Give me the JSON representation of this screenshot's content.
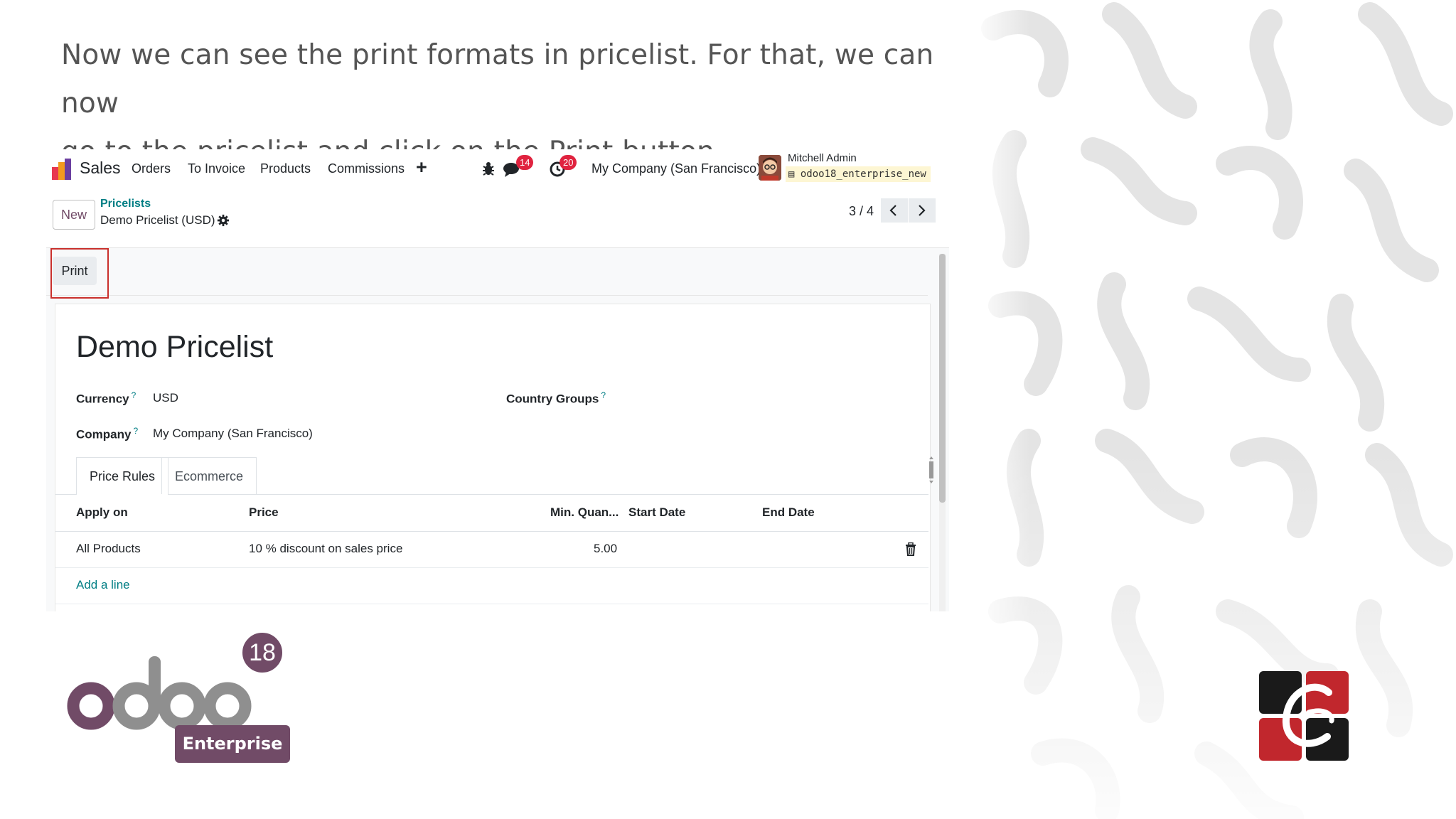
{
  "caption": {
    "line1": "Now we can see the print formats in pricelist. For that, we can now",
    "line2": "go to the pricelist and click on the Print button."
  },
  "navbar": {
    "app_name": "Sales",
    "menu": [
      "Orders",
      "To Invoice",
      "Products",
      "Commissions"
    ],
    "messages_count": "14",
    "activities_count": "20",
    "company": "My Company (San Francisco)",
    "user_name": "Mitchell Admin",
    "database": "odoo18_enterprise_new",
    "icons": [
      "plus-icon",
      "bug-icon",
      "chat-icon",
      "clock-icon"
    ]
  },
  "control_panel": {
    "new_label": "New",
    "breadcrumb_parent": "Pricelists",
    "breadcrumb_current": "Demo Pricelist (USD)",
    "pager": "3 / 4"
  },
  "statusbar": {
    "print_label": "Print"
  },
  "form": {
    "title": "Demo Pricelist",
    "currency_label": "Currency",
    "currency_value": "USD",
    "company_label": "Company",
    "company_value": "My Company (San Francisco)",
    "country_groups_label": "Country Groups",
    "help_mark": "?",
    "tabs": [
      "Price Rules",
      "Ecommerce"
    ],
    "columns": [
      "Apply on",
      "Price",
      "Min. Quan...",
      "Start Date",
      "End Date"
    ],
    "rows": [
      {
        "apply_on": "All Products",
        "price": "10 % discount on sales price",
        "min_qty": "5.00",
        "start": "",
        "end": ""
      }
    ],
    "add_line": "Add a line"
  },
  "footer": {
    "version": "18",
    "edition": "Enterprise"
  },
  "colors": {
    "odoo_purple": "#714b67",
    "link_teal": "#017e84",
    "highlight_red": "#c9302c",
    "badge_red": "#e0233f"
  }
}
